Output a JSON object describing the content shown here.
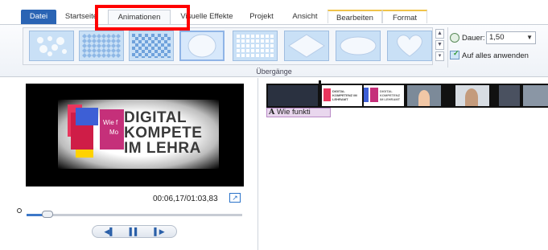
{
  "tabs": [
    {
      "label": "Datei"
    },
    {
      "label": "Startseite"
    },
    {
      "label": "Animationen"
    },
    {
      "label": "Visuelle Effekte"
    },
    {
      "label": "Projekt"
    },
    {
      "label": "Ansicht"
    },
    {
      "label": "Bearbeiten"
    },
    {
      "label": "Format"
    }
  ],
  "ribbon": {
    "group_label": "Übergänge",
    "duration_label": "Dauer:",
    "duration_value": "1,50",
    "apply_all_label": "Auf alles anwenden",
    "transitions": [
      {
        "icon": "transition-cross-dissolve-icon"
      },
      {
        "icon": "transition-diamond-pattern-icon"
      },
      {
        "icon": "transition-checkerboard-icon"
      },
      {
        "icon": "transition-circle-icon",
        "selected": true
      },
      {
        "icon": "transition-grid-icon"
      },
      {
        "icon": "transition-diamond-icon"
      },
      {
        "icon": "transition-oval-icon"
      },
      {
        "icon": "transition-heart-icon"
      }
    ]
  },
  "preview": {
    "logo_line1": "DIGITAL",
    "logo_line2": "KOMPETE",
    "logo_line3": "IM LEHRA",
    "overlay_line1": "Wie f",
    "overlay_line2": "Mo",
    "time": "00:06,17/01:03,83"
  },
  "playback": {
    "progress": 0.097,
    "prev_label": "◀▌",
    "pause_label": "▌▌",
    "next_label": "▌▶"
  },
  "storyboard": {
    "caption": "Wie funkti",
    "caption_icon": "A",
    "thumb_text_a": "DIGITAL KOMPETENZ IM LEHRAMT",
    "thumb_text_b": "DIGITAL KOMPETENZ IM LEHRAMT"
  },
  "colors": {
    "file_tab": "#2a64b4",
    "annotation": "#ff0000",
    "selection": "#8fb4e6",
    "caption_bg": "#e9d7ee"
  }
}
